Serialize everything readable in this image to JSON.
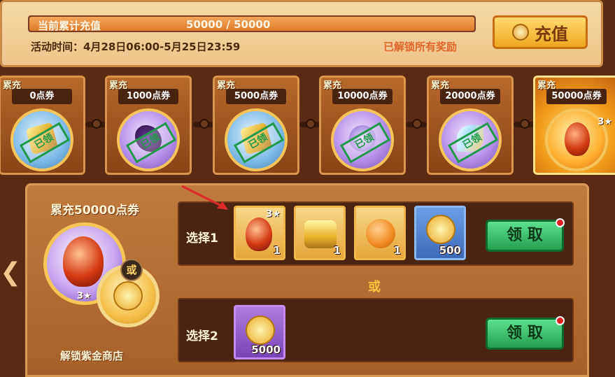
{
  "header": {
    "progress_label": "当前累计充值",
    "progress_value": "50000 / 50000",
    "progress_fraction": 1.0,
    "event_time": "活动时间：4月28日06:00-5月25日23:59",
    "unlock_status": "已解锁所有奖励",
    "recharge_label": "充值",
    "recharge_icon": "coin-icon"
  },
  "tiers": [
    {
      "tag": "累充",
      "label": "0点券",
      "stamp": "已领",
      "item": "gold-ingot-icon"
    },
    {
      "tag": "累充",
      "label": "1000点券",
      "stamp": "已领",
      "item": "dark-wing-icon"
    },
    {
      "tag": "累充",
      "label": "5000点券",
      "stamp": "已领",
      "item": "gold-box-icon"
    },
    {
      "tag": "累充",
      "label": "10000点券",
      "stamp": "已领",
      "item": "pet-icon"
    },
    {
      "tag": "累充",
      "label": "20000点券",
      "stamp": "已领",
      "item": "wing-icon"
    },
    {
      "tag": "累充",
      "label": "50000点券",
      "stars": "3★",
      "item": "egg-icon"
    }
  ],
  "reward": {
    "title": "累充50000点券",
    "stars": "3★",
    "or_badge": "或",
    "unlock_shop": "解锁紫金商店"
  },
  "option1": {
    "label": "选择1",
    "items": [
      {
        "icon": "fire-egg-icon",
        "stars": "3★",
        "count": "1"
      },
      {
        "icon": "gold-chest-icon",
        "count": "1"
      },
      {
        "icon": "yarn-ball-icon",
        "count": "1"
      },
      {
        "icon": "hammer-medal-icon",
        "count": "500"
      }
    ],
    "claim_label": "领 取"
  },
  "or_text": "或",
  "option2": {
    "label": "选择2",
    "items": [
      {
        "icon": "purple-gold-coin-icon",
        "count": "5000"
      }
    ],
    "claim_label": "领 取"
  },
  "colors": {
    "claim_green": "#25a04e",
    "stamp_green": "#1f9a4a",
    "status_orange": "#e0662a"
  }
}
